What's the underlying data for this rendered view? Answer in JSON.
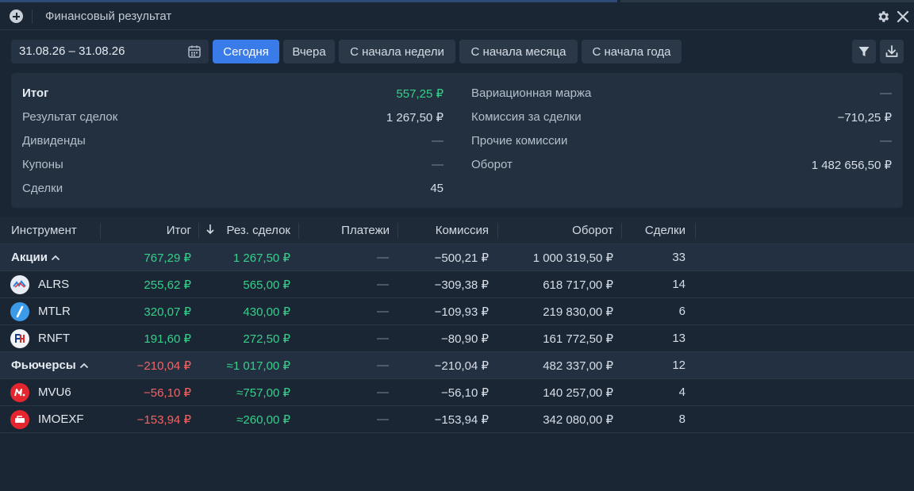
{
  "window": {
    "title": "Финансовый результат"
  },
  "toolbar": {
    "date_range": "31.08.26 – 31.08.26",
    "periods": [
      {
        "label": "Сегодня",
        "active": true
      },
      {
        "label": "Вчера",
        "active": false
      },
      {
        "label": "С начала недели",
        "active": false
      },
      {
        "label": "С начала месяца",
        "active": false
      },
      {
        "label": "С начала года",
        "active": false
      }
    ],
    "filter_icon": "filter-icon",
    "download_icon": "download-icon"
  },
  "summary": {
    "left": [
      {
        "label": "Итог",
        "value": "557,25 ₽"
      },
      {
        "label": "Результат сделок",
        "value": "1 267,50 ₽"
      },
      {
        "label": "Дивиденды",
        "value": "—"
      },
      {
        "label": "Купоны",
        "value": "—"
      },
      {
        "label": "Сделки",
        "value": "45"
      }
    ],
    "right": [
      {
        "label": "Вариационная маржа",
        "value": "—"
      },
      {
        "label": "Комиссия за сделки",
        "value": "−710,25 ₽"
      },
      {
        "label": "Прочие комиссии",
        "value": "—"
      },
      {
        "label": "Оборот",
        "value": "1 482 656,50 ₽"
      }
    ]
  },
  "table": {
    "columns": {
      "instrument": "Инструмент",
      "total": "Итог",
      "trade_result": "Рез. сделок",
      "payments": "Платежи",
      "commission": "Комиссия",
      "turnover": "Оборот",
      "trades": "Сделки"
    },
    "rows": [
      {
        "kind": "group",
        "name": "Акции",
        "total": "767,29 ₽",
        "trade_result": "1 267,50 ₽",
        "payments": "—",
        "commission": "−500,21 ₽",
        "turnover": "1 000 319,50 ₽",
        "trades": "33"
      },
      {
        "kind": "item",
        "name": "ALRS",
        "logo": "alrosa-logo",
        "total": "255,62 ₽",
        "trade_result": "565,00 ₽",
        "payments": "—",
        "commission": "−309,38 ₽",
        "turnover": "618 717,00 ₽",
        "trades": "14"
      },
      {
        "kind": "item",
        "name": "MTLR",
        "logo": "mechel-logo",
        "total": "320,07 ₽",
        "trade_result": "430,00 ₽",
        "payments": "—",
        "commission": "−109,93 ₽",
        "turnover": "219 830,00 ₽",
        "trades": "6"
      },
      {
        "kind": "item",
        "name": "RNFT",
        "logo": "russneft-logo",
        "total": "191,60 ₽",
        "trade_result": "272,50 ₽",
        "payments": "—",
        "commission": "−80,90 ₽",
        "turnover": "161 772,50 ₽",
        "trades": "13"
      },
      {
        "kind": "group",
        "name": "Фьючерсы",
        "total": "−210,04 ₽",
        "trade_result": "≈1 017,00 ₽",
        "payments": "—",
        "commission": "−210,04 ₽",
        "turnover": "482 337,00 ₽",
        "trades": "12"
      },
      {
        "kind": "item",
        "name": "MVU6",
        "logo": "mvideo-logo",
        "total": "−56,10 ₽",
        "trade_result": "≈757,00 ₽",
        "payments": "—",
        "commission": "−56,10 ₽",
        "turnover": "140 257,00 ₽",
        "trades": "4"
      },
      {
        "kind": "item",
        "name": "IMOEXF",
        "logo": "moex-logo",
        "total": "−153,94 ₽",
        "trade_result": "≈260,00 ₽",
        "payments": "—",
        "commission": "−153,94 ₽",
        "turnover": "342 080,00 ₽",
        "trades": "8"
      }
    ]
  },
  "colors": {
    "positive": "#36d08a",
    "negative": "#f26464",
    "accent": "#3a7bea"
  }
}
